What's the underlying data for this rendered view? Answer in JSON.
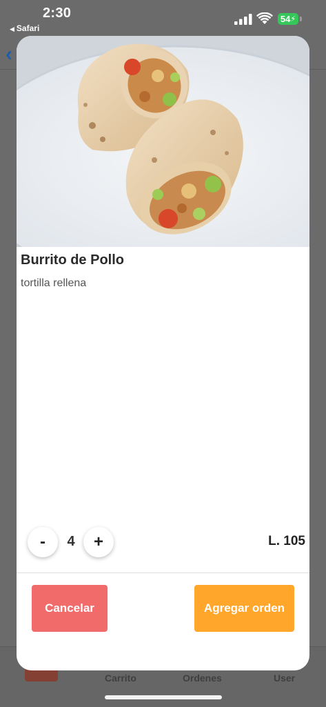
{
  "status_bar": {
    "time": "2:30",
    "back_app": "Safari",
    "battery": "54"
  },
  "background": {
    "tabs": [
      "Carrito",
      "Ordenes",
      "User"
    ]
  },
  "modal": {
    "title": "Burrito de Pollo",
    "description": "tortilla rellena",
    "quantity": "4",
    "minus_label": "-",
    "plus_label": "+",
    "price": "L. 105",
    "cancel_label": "Cancelar",
    "add_label": "Agregar orden"
  },
  "colors": {
    "cancel": "#f26b6b",
    "add": "#ffa62b",
    "battery": "#35c759",
    "overlay": "#6b6b6b"
  }
}
